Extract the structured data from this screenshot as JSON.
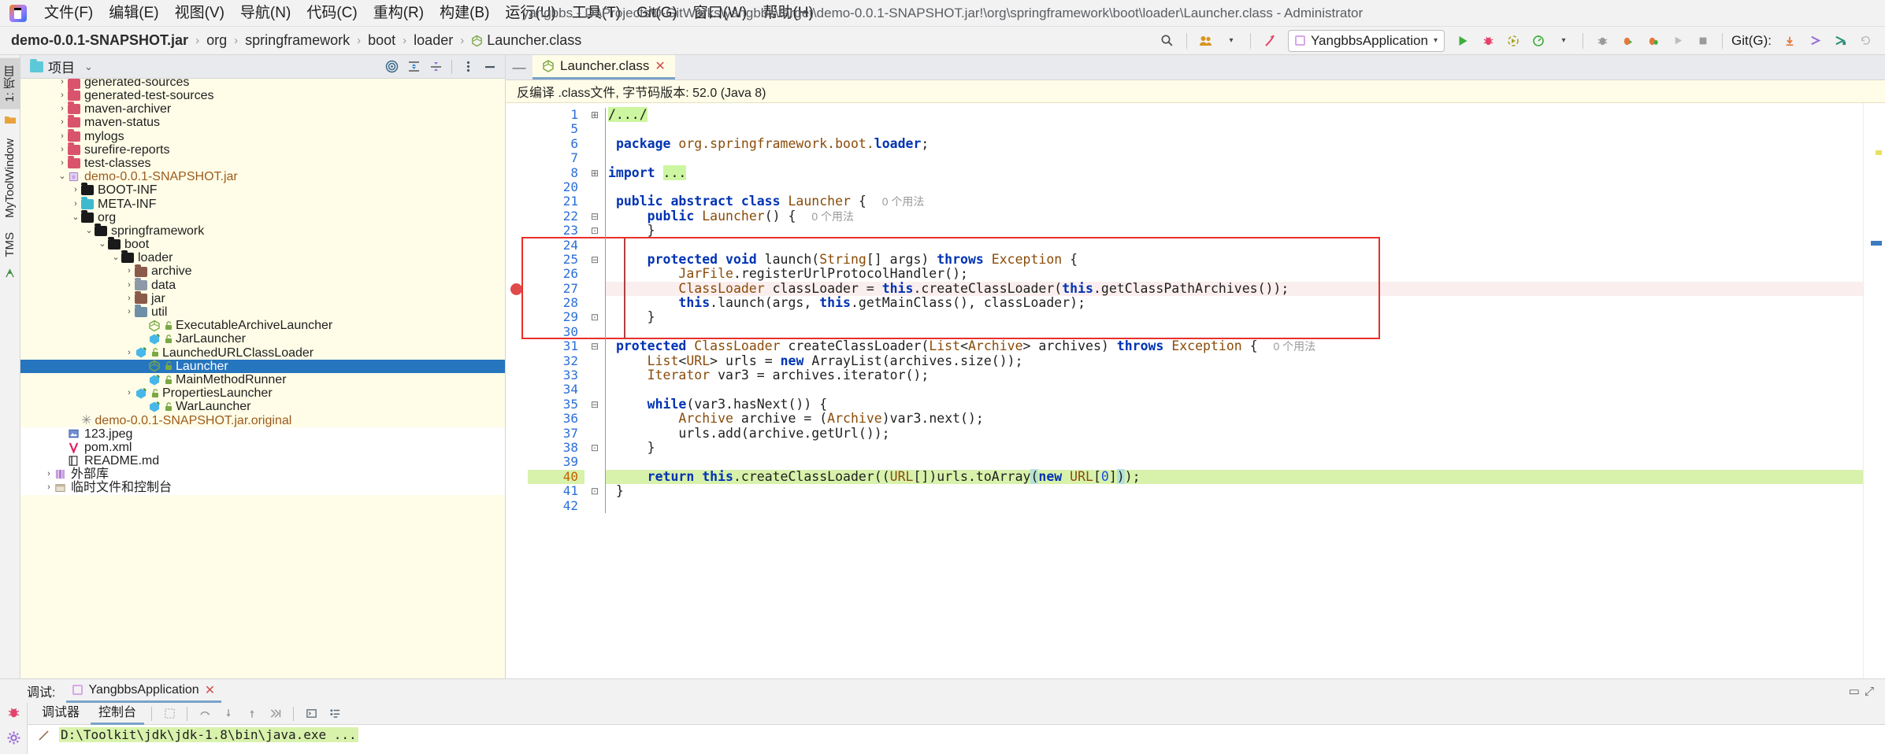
{
  "window": {
    "title": "yangbbs - D:\\Projects\\0-GitWorks\\yangbbs\\target\\demo-0.0.1-SNAPSHOT.jar!\\org\\springframework\\boot\\loader\\Launcher.class - Administrator",
    "logo_name": "intellij-idea-logo"
  },
  "menu": {
    "items": [
      {
        "label": "文件(F)"
      },
      {
        "label": "编辑(E)"
      },
      {
        "label": "视图(V)"
      },
      {
        "label": "导航(N)"
      },
      {
        "label": "代码(C)"
      },
      {
        "label": "重构(R)"
      },
      {
        "label": "构建(B)"
      },
      {
        "label": "运行(U)"
      },
      {
        "label": "工具(T)"
      },
      {
        "label": "Git(G)"
      },
      {
        "label": "窗口(W)"
      },
      {
        "label": "帮助(H)"
      }
    ]
  },
  "breadcrumb": {
    "items": [
      {
        "label": "demo-0.0.1-SNAPSHOT.jar",
        "icon": "jar-icon"
      },
      {
        "label": "org",
        "icon": ""
      },
      {
        "label": "springframework",
        "icon": ""
      },
      {
        "label": "boot",
        "icon": ""
      },
      {
        "label": "loader",
        "icon": ""
      },
      {
        "label": "Launcher.class",
        "icon": "class-icon"
      }
    ],
    "separator": "›"
  },
  "toolbar": {
    "search_everywhere_icon": "search-icon",
    "users_icon": "users-icon",
    "pointer_icon": "select-run-icon",
    "run_config": {
      "label": "YangbbsApplication",
      "dropdown_caret": "▾"
    },
    "run_icon": "run-icon",
    "debug_icon": "debug-icon",
    "run_coverage_icon": "run-with-coverage-icon",
    "profiler_icon": "profiler-icon",
    "attach_icon": "attach-process-icon",
    "rerun_debug_icon": "rerun-debug-icon",
    "debug_extra_icon": "debug-extra-icon",
    "run_disabled_icon": "run-disabled-icon",
    "stop_icon": "stop-icon",
    "git_label": "Git(G):",
    "git_update_icon": "git-update-icon",
    "git_push_icon": "git-push-icon",
    "git_commit_icon": "git-commit-icon",
    "git_history_icon": "git-history-icon"
  },
  "left_strip": {
    "tabs": [
      {
        "label": "1: 项目",
        "active": true
      },
      {
        "label": "MyToolWindow",
        "active": false
      },
      {
        "label": "TMS",
        "active": false
      }
    ]
  },
  "project_panel": {
    "title": "项目",
    "title_icon": "project-folder-icon",
    "collapse_caret": "⌄",
    "tools": [
      {
        "name": "locate-icon",
        "glyph": "◎"
      },
      {
        "name": "expand-all-icon",
        "glyph": "⇳"
      },
      {
        "name": "collapse-all-icon",
        "glyph": "⇱"
      },
      {
        "name": "more-options-icon",
        "glyph": "⋮"
      },
      {
        "name": "hide-panel-icon",
        "glyph": "—"
      }
    ],
    "tree": [
      {
        "label": "generated-sources",
        "indent": 2,
        "arrow": "›",
        "icon": "folder-pink",
        "partial": true
      },
      {
        "label": "generated-test-sources",
        "indent": 2,
        "arrow": "›",
        "icon": "folder-pink"
      },
      {
        "label": "maven-archiver",
        "indent": 2,
        "arrow": "›",
        "icon": "folder-pink"
      },
      {
        "label": "maven-status",
        "indent": 2,
        "arrow": "›",
        "icon": "folder-pink"
      },
      {
        "label": "mylogs",
        "indent": 2,
        "arrow": "›",
        "icon": "folder-pink"
      },
      {
        "label": "surefire-reports",
        "indent": 2,
        "arrow": "›",
        "icon": "folder-pink"
      },
      {
        "label": "test-classes",
        "indent": 2,
        "arrow": "›",
        "icon": "folder-pink"
      },
      {
        "label": "demo-0.0.1-SNAPSHOT.jar",
        "indent": 2,
        "arrow": "⌄",
        "icon": "jar",
        "color": "jar"
      },
      {
        "label": "BOOT-INF",
        "indent": 3,
        "arrow": "›",
        "icon": "folder-black"
      },
      {
        "label": "META-INF",
        "indent": 3,
        "arrow": "›",
        "icon": "folder-teal"
      },
      {
        "label": "org",
        "indent": 3,
        "arrow": "⌄",
        "icon": "folder-black"
      },
      {
        "label": "springframework",
        "indent": 4,
        "arrow": "⌄",
        "icon": "folder-black"
      },
      {
        "label": "boot",
        "indent": 5,
        "arrow": "⌄",
        "icon": "folder-black"
      },
      {
        "label": "loader",
        "indent": 6,
        "arrow": "⌄",
        "icon": "folder-black"
      },
      {
        "label": "archive",
        "indent": 7,
        "arrow": "›",
        "icon": "folder-brown"
      },
      {
        "label": "data",
        "indent": 7,
        "arrow": "›",
        "icon": "folder-gray"
      },
      {
        "label": "jar",
        "indent": 7,
        "arrow": "›",
        "icon": "folder-brown"
      },
      {
        "label": "util",
        "indent": 7,
        "arrow": "›",
        "icon": "folder-blue"
      },
      {
        "label": "ExecutableArchiveLauncher",
        "indent": 8,
        "arrow": "",
        "icon": "class-green-out",
        "lock": "🔓"
      },
      {
        "label": "JarLauncher",
        "indent": 8,
        "arrow": "",
        "icon": "class-blue",
        "lock": "🔓"
      },
      {
        "label": "LaunchedURLClassLoader",
        "indent": 7,
        "arrow": "›",
        "icon": "class-blue",
        "lock": "🔓"
      },
      {
        "label": "Launcher",
        "indent": 8,
        "arrow": "",
        "icon": "class-green-out",
        "lock": "🔓",
        "selected": true
      },
      {
        "label": "MainMethodRunner",
        "indent": 8,
        "arrow": "",
        "icon": "class-blue",
        "lock": "🔓"
      },
      {
        "label": "PropertiesLauncher",
        "indent": 7,
        "arrow": "›",
        "icon": "class-blue",
        "lock": "🔓"
      },
      {
        "label": "WarLauncher",
        "indent": 8,
        "arrow": "",
        "icon": "class-blue",
        "lock": "🔓"
      },
      {
        "label": "demo-0.0.1-SNAPSHOT.jar.original",
        "indent": 3,
        "arrow": "",
        "icon": "scratch",
        "color": "jar",
        "star": "✳"
      },
      {
        "label": "123.jpeg",
        "indent": 2,
        "arrow": "",
        "icon": "img",
        "white": true
      },
      {
        "label": "pom.xml",
        "indent": 2,
        "arrow": "",
        "icon": "maven",
        "white": true
      },
      {
        "label": "README.md",
        "indent": 2,
        "arrow": "",
        "icon": "mdfile",
        "white": true
      },
      {
        "label": "外部库",
        "indent": 1,
        "arrow": "›",
        "icon": "lib",
        "white": true
      },
      {
        "label": "临时文件和控制台",
        "indent": 1,
        "arrow": "›",
        "icon": "console",
        "white": true
      }
    ]
  },
  "editor": {
    "collapse_icon": "collapse-editor-icon",
    "tab": {
      "label": "Launcher.class",
      "icon": "class-icon",
      "close_icon": "close-icon"
    },
    "decompile_notice": "反编译 .class文件, 字节码版本: 52.0 (Java 8)",
    "breakpoint_line": 27,
    "highlighted_region": {
      "from_line": 24,
      "to_line": 30
    },
    "execution_line": 40,
    "lines": [
      {
        "n": "1",
        "fold": "⊞",
        "html": "<span class=\"greenhl\">/.../</span>"
      },
      {
        "n": "5",
        "fold": "",
        "html": ""
      },
      {
        "n": "6",
        "fold": "",
        "html": " <span class=\"kw\">package</span> <span class=\"cls\">org.springframework.boot.</span><span class=\"kw\">loader</span>;"
      },
      {
        "n": "7",
        "fold": "",
        "html": ""
      },
      {
        "n": "8",
        "fold": "⊞",
        "html": "<span class=\"kw\">import</span> <span class=\"greenhl\">...</span>"
      },
      {
        "n": "20",
        "fold": "",
        "html": ""
      },
      {
        "n": "21",
        "fold": "",
        "html": " <span class=\"kw\">public abstract class</span> <span class=\"cls\">Launcher</span> {  <span class=\"usage\">0 个用法</span>"
      },
      {
        "n": "22",
        "fold": "⊟",
        "html": "     <span class=\"kw\">public</span> <span class=\"cls\">Launcher</span>() {  <span class=\"usage\">0 个用法</span>"
      },
      {
        "n": "23",
        "fold": "⊡",
        "html": "     }"
      },
      {
        "n": "24",
        "fold": "",
        "html": ""
      },
      {
        "n": "25",
        "fold": "⊟",
        "html": "     <span class=\"kw\">protected void</span> launch(<span class=\"cls\">String</span>[] args) <span class=\"kw\">throws</span> <span class=\"cls\">Exception</span> {"
      },
      {
        "n": "26",
        "fold": "",
        "html": "         <span class=\"cls\">JarFile</span>.registerUrlProtocolHandler();"
      },
      {
        "n": "27",
        "fold": "",
        "html": "         <span class=\"cls\">ClassLoader</span> classLoader = <span class=\"kw\">this</span>.createClassLoader(<span class=\"kw\">this</span>.getClassPathArchives());"
      },
      {
        "n": "28",
        "fold": "",
        "html": "         <span class=\"kw\">this</span>.launch(args, <span class=\"kw\">this</span>.getMainClass(), classLoader);"
      },
      {
        "n": "29",
        "fold": "⊡",
        "html": "     }"
      },
      {
        "n": "30",
        "fold": "",
        "html": ""
      },
      {
        "n": "31",
        "fold": "⊟",
        "html": " <span class=\"kw\">protected</span> <span class=\"cls\">ClassLoader</span> createClassLoader(<span class=\"cls\">List</span>&lt;<span class=\"cls\">Archive</span>&gt; archives) <span class=\"kw\">throws</span> <span class=\"cls\">Exception</span> {  <span class=\"usage\">0 个用法</span>"
      },
      {
        "n": "32",
        "fold": "",
        "html": "     <span class=\"cls\">List</span>&lt;<span class=\"cls\">URL</span>&gt; urls = <span class=\"kw\">new</span> ArrayList(archives.size());"
      },
      {
        "n": "33",
        "fold": "",
        "html": "     <span class=\"cls\">Iterator</span> var3 = archives.iterator();"
      },
      {
        "n": "34",
        "fold": "",
        "html": ""
      },
      {
        "n": "35",
        "fold": "⊟",
        "html": "     <span class=\"kw\">while</span>(var3.hasNext()) {"
      },
      {
        "n": "36",
        "fold": "",
        "html": "         <span class=\"cls\">Archive</span> archive = (<span class=\"cls\">Archive</span>)var3.next();"
      },
      {
        "n": "37",
        "fold": "",
        "html": "         urls.add(archive.getUrl());"
      },
      {
        "n": "38",
        "fold": "⊡",
        "html": "     }"
      },
      {
        "n": "39",
        "fold": "",
        "html": ""
      },
      {
        "n": "40",
        "fold": "",
        "html": "     <span class=\"kw\">return this</span>.createClassLoader((<span class=\"cls\">URL</span>[])urls.toArray<span class=\"brmatch\">(</span><span class=\"kw\">new</span> <span class=\"cls\">URL</span>[<span class=\"num\">0</span>]<span class=\"brmatch\">)</span>);"
      },
      {
        "n": "41",
        "fold": "⊡",
        "html": " }"
      },
      {
        "n": "42",
        "fold": "",
        "html": ""
      }
    ]
  },
  "debug_panel": {
    "label": "调试:",
    "tab": {
      "label": "YangbbsApplication",
      "close_icon": "close-icon",
      "icon": "run-config-icon"
    },
    "side_icons": [
      {
        "name": "debug-bug-icon",
        "glyph": "🐞"
      },
      {
        "name": "settings-gear-icon",
        "glyph": "⚙"
      }
    ],
    "subtabs": [
      {
        "label": "调试器",
        "active": false
      },
      {
        "label": "控制台",
        "active": true
      }
    ],
    "tools": [
      {
        "name": "layout-icon",
        "glyph": "▣"
      },
      {
        "name": "step-over-icon",
        "glyph": "↷"
      },
      {
        "name": "step-into-icon",
        "glyph": "↓"
      },
      {
        "name": "step-out-icon",
        "glyph": "↑"
      },
      {
        "name": "run-to-cursor-icon",
        "glyph": "⇥"
      },
      {
        "name": "console-icon",
        "glyph": "▣"
      },
      {
        "name": "watches-icon",
        "glyph": "≔"
      }
    ],
    "console_edit_icon": "edit-pencil-icon",
    "console_line": "D:\\Toolkit\\jdk\\jdk-1.8\\bin\\java.exe ..."
  },
  "colors": {
    "selection_blue": "#2675bf",
    "panel_yellow": "#fffde7",
    "highlight_red": "#e8302a",
    "exec_green": "#d8f2ac",
    "breakpoint_red": "#e04a4a"
  }
}
